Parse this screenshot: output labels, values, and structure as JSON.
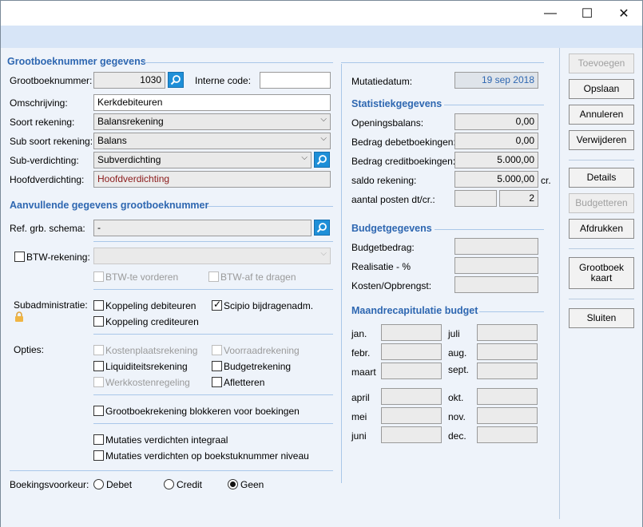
{
  "window": {
    "controls": {
      "minimize": "—",
      "maximize": "☐",
      "close": "✕"
    }
  },
  "left": {
    "section1_title": "Grootboeknummer gegevens",
    "grootboeknummer_label": "Grootboeknummer:",
    "grootboeknummer_value": "1030",
    "interne_code_label": "Interne code:",
    "interne_code_value": "",
    "omschrijving_label": "Omschrijving:",
    "omschrijving_value": "Kerkdebiteuren",
    "soort_label": "Soort rekening:",
    "soort_value": "Balansrekening",
    "subsoort_label": "Sub soort rekening:",
    "subsoort_value": "Balans",
    "subverdichting_label": "Sub-verdichting:",
    "subverdichting_value": "Subverdichting",
    "hoofdverdichting_label": "Hoofdverdichting:",
    "hoofdverdichting_value": "Hoofdverdichting",
    "section2_title": "Aanvullende gegevens grootboeknummer",
    "ref_label": "Ref. grb. schema:",
    "ref_value": "-",
    "btw_label": "BTW-rekening:",
    "btw_value": "",
    "btw_vorderen": "BTW-te vorderen",
    "btw_afdragen": "BTW-af te dragen",
    "subadmin_label": "Subadministratie:",
    "koppeling_debiteuren": "Koppeling debiteuren",
    "koppeling_crediteuren": "Koppeling crediteuren",
    "scipio": "Scipio bijdragenadm.",
    "opties_label": "Opties:",
    "kostenplaats": "Kostenplaatsrekening",
    "voorraad": "Voorraadrekening",
    "liquiditeit": "Liquiditeitsrekening",
    "budget": "Budgetrekening",
    "werkkosten": "Werkkostenregeling",
    "afletteren": "Afletteren",
    "blokkeren": "Grootboekrekening blokkeren voor boekingen",
    "verdichten_integraal": "Mutaties verdichten integraal",
    "verdichten_boekstuk": "Mutaties verdichten op boekstuknummer niveau",
    "boekingsvoorkeur_label": "Boekingsvoorkeur:",
    "radio_debet": "Debet",
    "radio_credit": "Credit",
    "radio_geen": "Geen"
  },
  "middle": {
    "mutatiedatum_label": "Mutatiedatum:",
    "mutatiedatum_value": "19 sep 2018",
    "stat_title": "Statistiekgegevens",
    "openingsbalans_label": "Openingsbalans:",
    "openingsbalans_value": "0,00",
    "debet_label": "Bedrag debetboekingen:",
    "debet_value": "0,00",
    "credit_label": "Bedrag creditboekingen:",
    "credit_value": "5.000,00",
    "saldo_label": "saldo rekening:",
    "saldo_value": "5.000,00",
    "saldo_suffix": "cr.",
    "posten_label": "aantal posten dt/cr.:",
    "posten_dt": "",
    "posten_cr": "2",
    "budget_title": "Budgetgegevens",
    "budgetbedrag_label": "Budgetbedrag:",
    "realisatie_label": "Realisatie - %",
    "kosten_label": "Kosten/Opbrengst:",
    "maand_title": "Maandrecapitulatie budget",
    "months_left": [
      "jan.",
      "febr.",
      "maart",
      "april",
      "mei",
      "juni"
    ],
    "months_right": [
      "juli",
      "aug.",
      "sept.",
      "okt.",
      "nov.",
      "dec."
    ]
  },
  "buttons": {
    "toevoegen": "Toevoegen",
    "opslaan": "Opslaan",
    "annuleren": "Annuleren",
    "verwijderen": "Verwijderen",
    "details": "Details",
    "budgetteren": "Budgetteren",
    "afdrukken": "Afdrukken",
    "grootboek_kaart_1": "Grootboek",
    "grootboek_kaart_2": "kaart",
    "sluiten": "Sluiten"
  }
}
